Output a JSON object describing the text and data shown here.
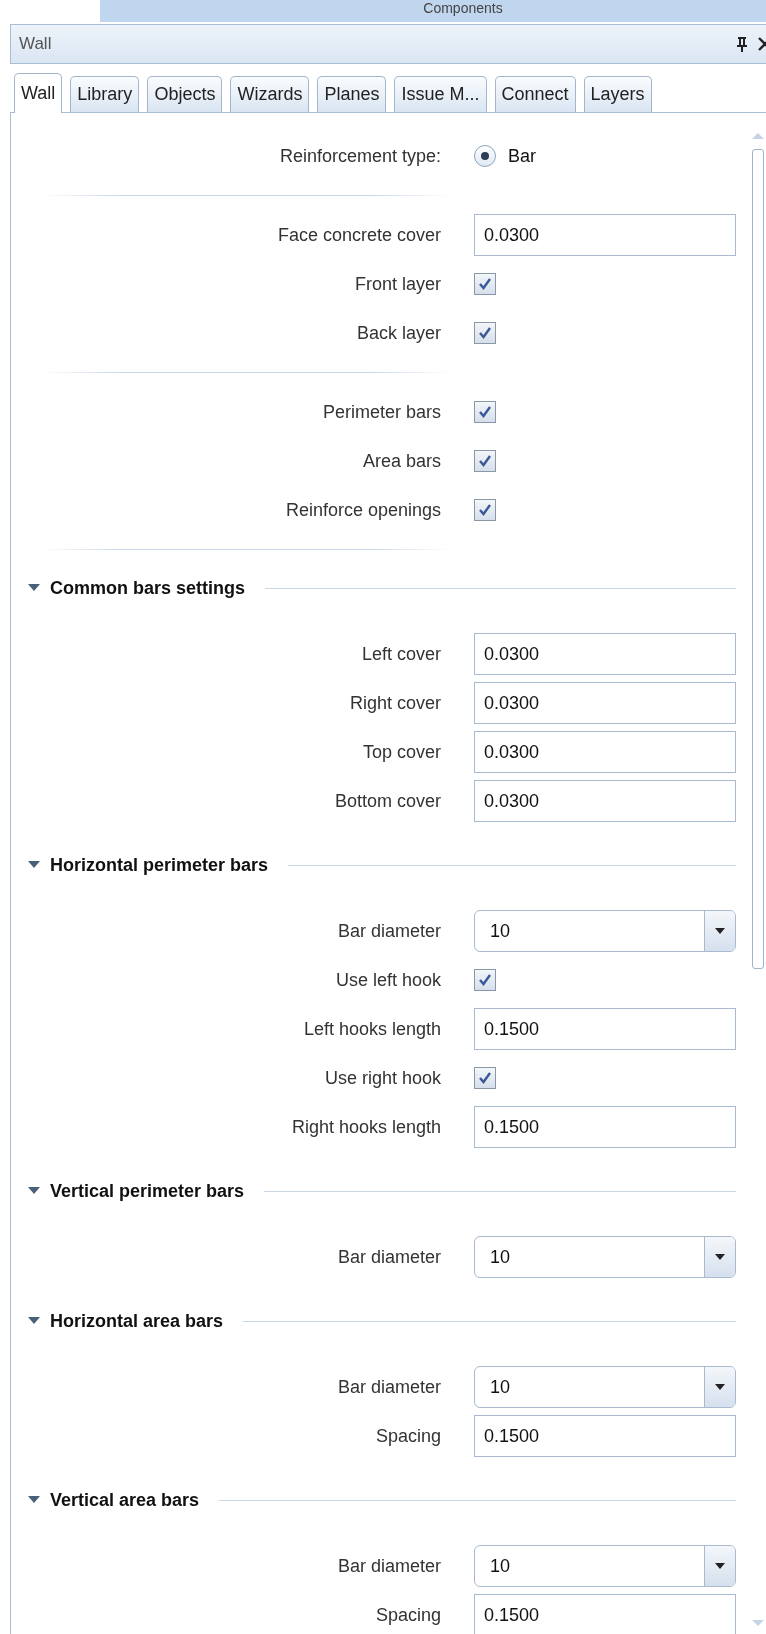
{
  "top_strip": {
    "title": "Components"
  },
  "panel": {
    "title": "Wall"
  },
  "tabs": [
    {
      "label": "Wall",
      "selected": true
    },
    {
      "label": "Library",
      "selected": false
    },
    {
      "label": "Objects",
      "selected": false
    },
    {
      "label": "Wizards",
      "selected": false
    },
    {
      "label": "Planes",
      "selected": false
    },
    {
      "label": "Issue M...",
      "selected": false
    },
    {
      "label": "Connect",
      "selected": false
    },
    {
      "label": "Layers",
      "selected": false
    }
  ],
  "plain_groups": [
    {
      "rows": [
        {
          "kind": "radio",
          "label": "Reinforcement type:",
          "option": "Bar",
          "selected": true
        }
      ]
    },
    {
      "rows": [
        {
          "kind": "input",
          "label": "Face concrete cover",
          "value": "0.0300"
        },
        {
          "kind": "checkbox",
          "label": "Front layer",
          "checked": true
        },
        {
          "kind": "checkbox",
          "label": "Back layer",
          "checked": true
        }
      ]
    },
    {
      "rows": [
        {
          "kind": "checkbox",
          "label": "Perimeter bars",
          "checked": true
        },
        {
          "kind": "checkbox",
          "label": "Area bars",
          "checked": true
        },
        {
          "kind": "checkbox",
          "label": "Reinforce openings",
          "checked": true
        }
      ]
    }
  ],
  "sections": [
    {
      "title": "Common bars settings",
      "expanded": true,
      "rows": [
        {
          "kind": "input",
          "label": "Left cover",
          "value": "0.0300"
        },
        {
          "kind": "input",
          "label": "Right cover",
          "value": "0.0300"
        },
        {
          "kind": "input",
          "label": "Top cover",
          "value": "0.0300"
        },
        {
          "kind": "input",
          "label": "Bottom cover",
          "value": "0.0300"
        }
      ]
    },
    {
      "title": "Horizontal perimeter bars",
      "expanded": true,
      "rows": [
        {
          "kind": "select",
          "label": "Bar diameter",
          "value": "10"
        },
        {
          "kind": "checkbox",
          "label": "Use left hook",
          "checked": true
        },
        {
          "kind": "input",
          "label": "Left hooks length",
          "value": "0.1500"
        },
        {
          "kind": "checkbox",
          "label": "Use right hook",
          "checked": true
        },
        {
          "kind": "input",
          "label": "Right hooks length",
          "value": "0.1500"
        }
      ]
    },
    {
      "title": "Vertical perimeter bars",
      "expanded": true,
      "rows": [
        {
          "kind": "select",
          "label": "Bar diameter",
          "value": "10"
        }
      ]
    },
    {
      "title": "Horizontal area bars",
      "expanded": true,
      "rows": [
        {
          "kind": "select",
          "label": "Bar diameter",
          "value": "10"
        },
        {
          "kind": "input",
          "label": "Spacing",
          "value": "0.1500"
        }
      ]
    },
    {
      "title": "Vertical area bars",
      "expanded": true,
      "rows": [
        {
          "kind": "select",
          "label": "Bar diameter",
          "value": "10"
        },
        {
          "kind": "input",
          "label": "Spacing",
          "value": "0.1500"
        }
      ]
    }
  ]
}
